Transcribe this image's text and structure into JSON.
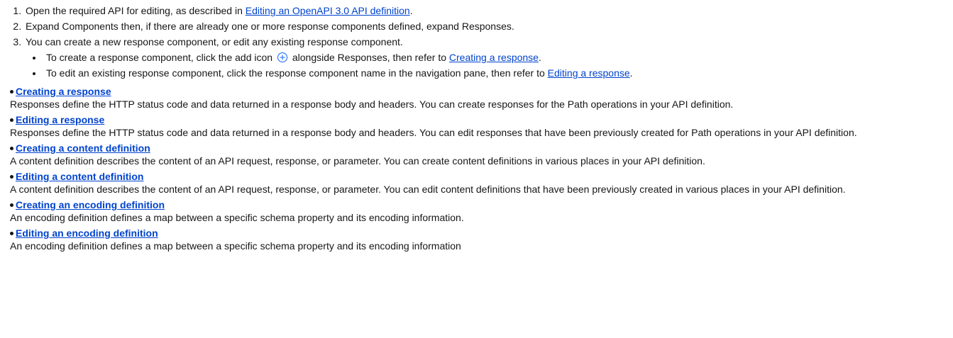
{
  "steps": [
    {
      "before": "Open the required API for editing, as described in ",
      "link": "Editing an OpenAPI 3.0 API definition",
      "after": "."
    },
    {
      "text": "Expand Components then, if there are already one or more response components defined, expand Responses."
    },
    {
      "text": "You can create a new response component, or edit any existing response component.",
      "substeps": [
        {
          "before": "To create a response component, click the add icon ",
          "icon": "add-circle-icon",
          "middle": " alongside Responses, then refer to ",
          "link": "Creating a response",
          "after": "."
        },
        {
          "before": "To edit an existing response component, click the response component name in the navigation pane, then refer to ",
          "link": "Editing a response",
          "after": "."
        }
      ]
    }
  ],
  "related": [
    {
      "title": "Creating a response",
      "desc": "Responses define the HTTP status code and data returned in a response body and headers. You can create responses for the Path operations in your API definition."
    },
    {
      "title": "Editing a response",
      "desc": "Responses define the HTTP status code and data returned in a response body and headers. You can edit responses that have been previously created for Path operations in your API definition."
    },
    {
      "title": "Creating a content definition",
      "desc": "A content definition describes the content of an API request, response, or parameter. You can create content definitions in various places in your API definition."
    },
    {
      "title": "Editing a content definition",
      "desc": "A content definition describes the content of an API request, response, or parameter. You can edit content definitions that have been previously created in various places in your API definition."
    },
    {
      "title": "Creating an encoding definition",
      "desc": "An encoding definition defines a map between a specific schema property and its encoding information."
    },
    {
      "title": "Editing an encoding definition",
      "desc": "An encoding definition defines a map between a specific schema property and its encoding information"
    }
  ],
  "colors": {
    "link": "#0043ce",
    "text": "#161616",
    "icon": "#0f62fe"
  }
}
